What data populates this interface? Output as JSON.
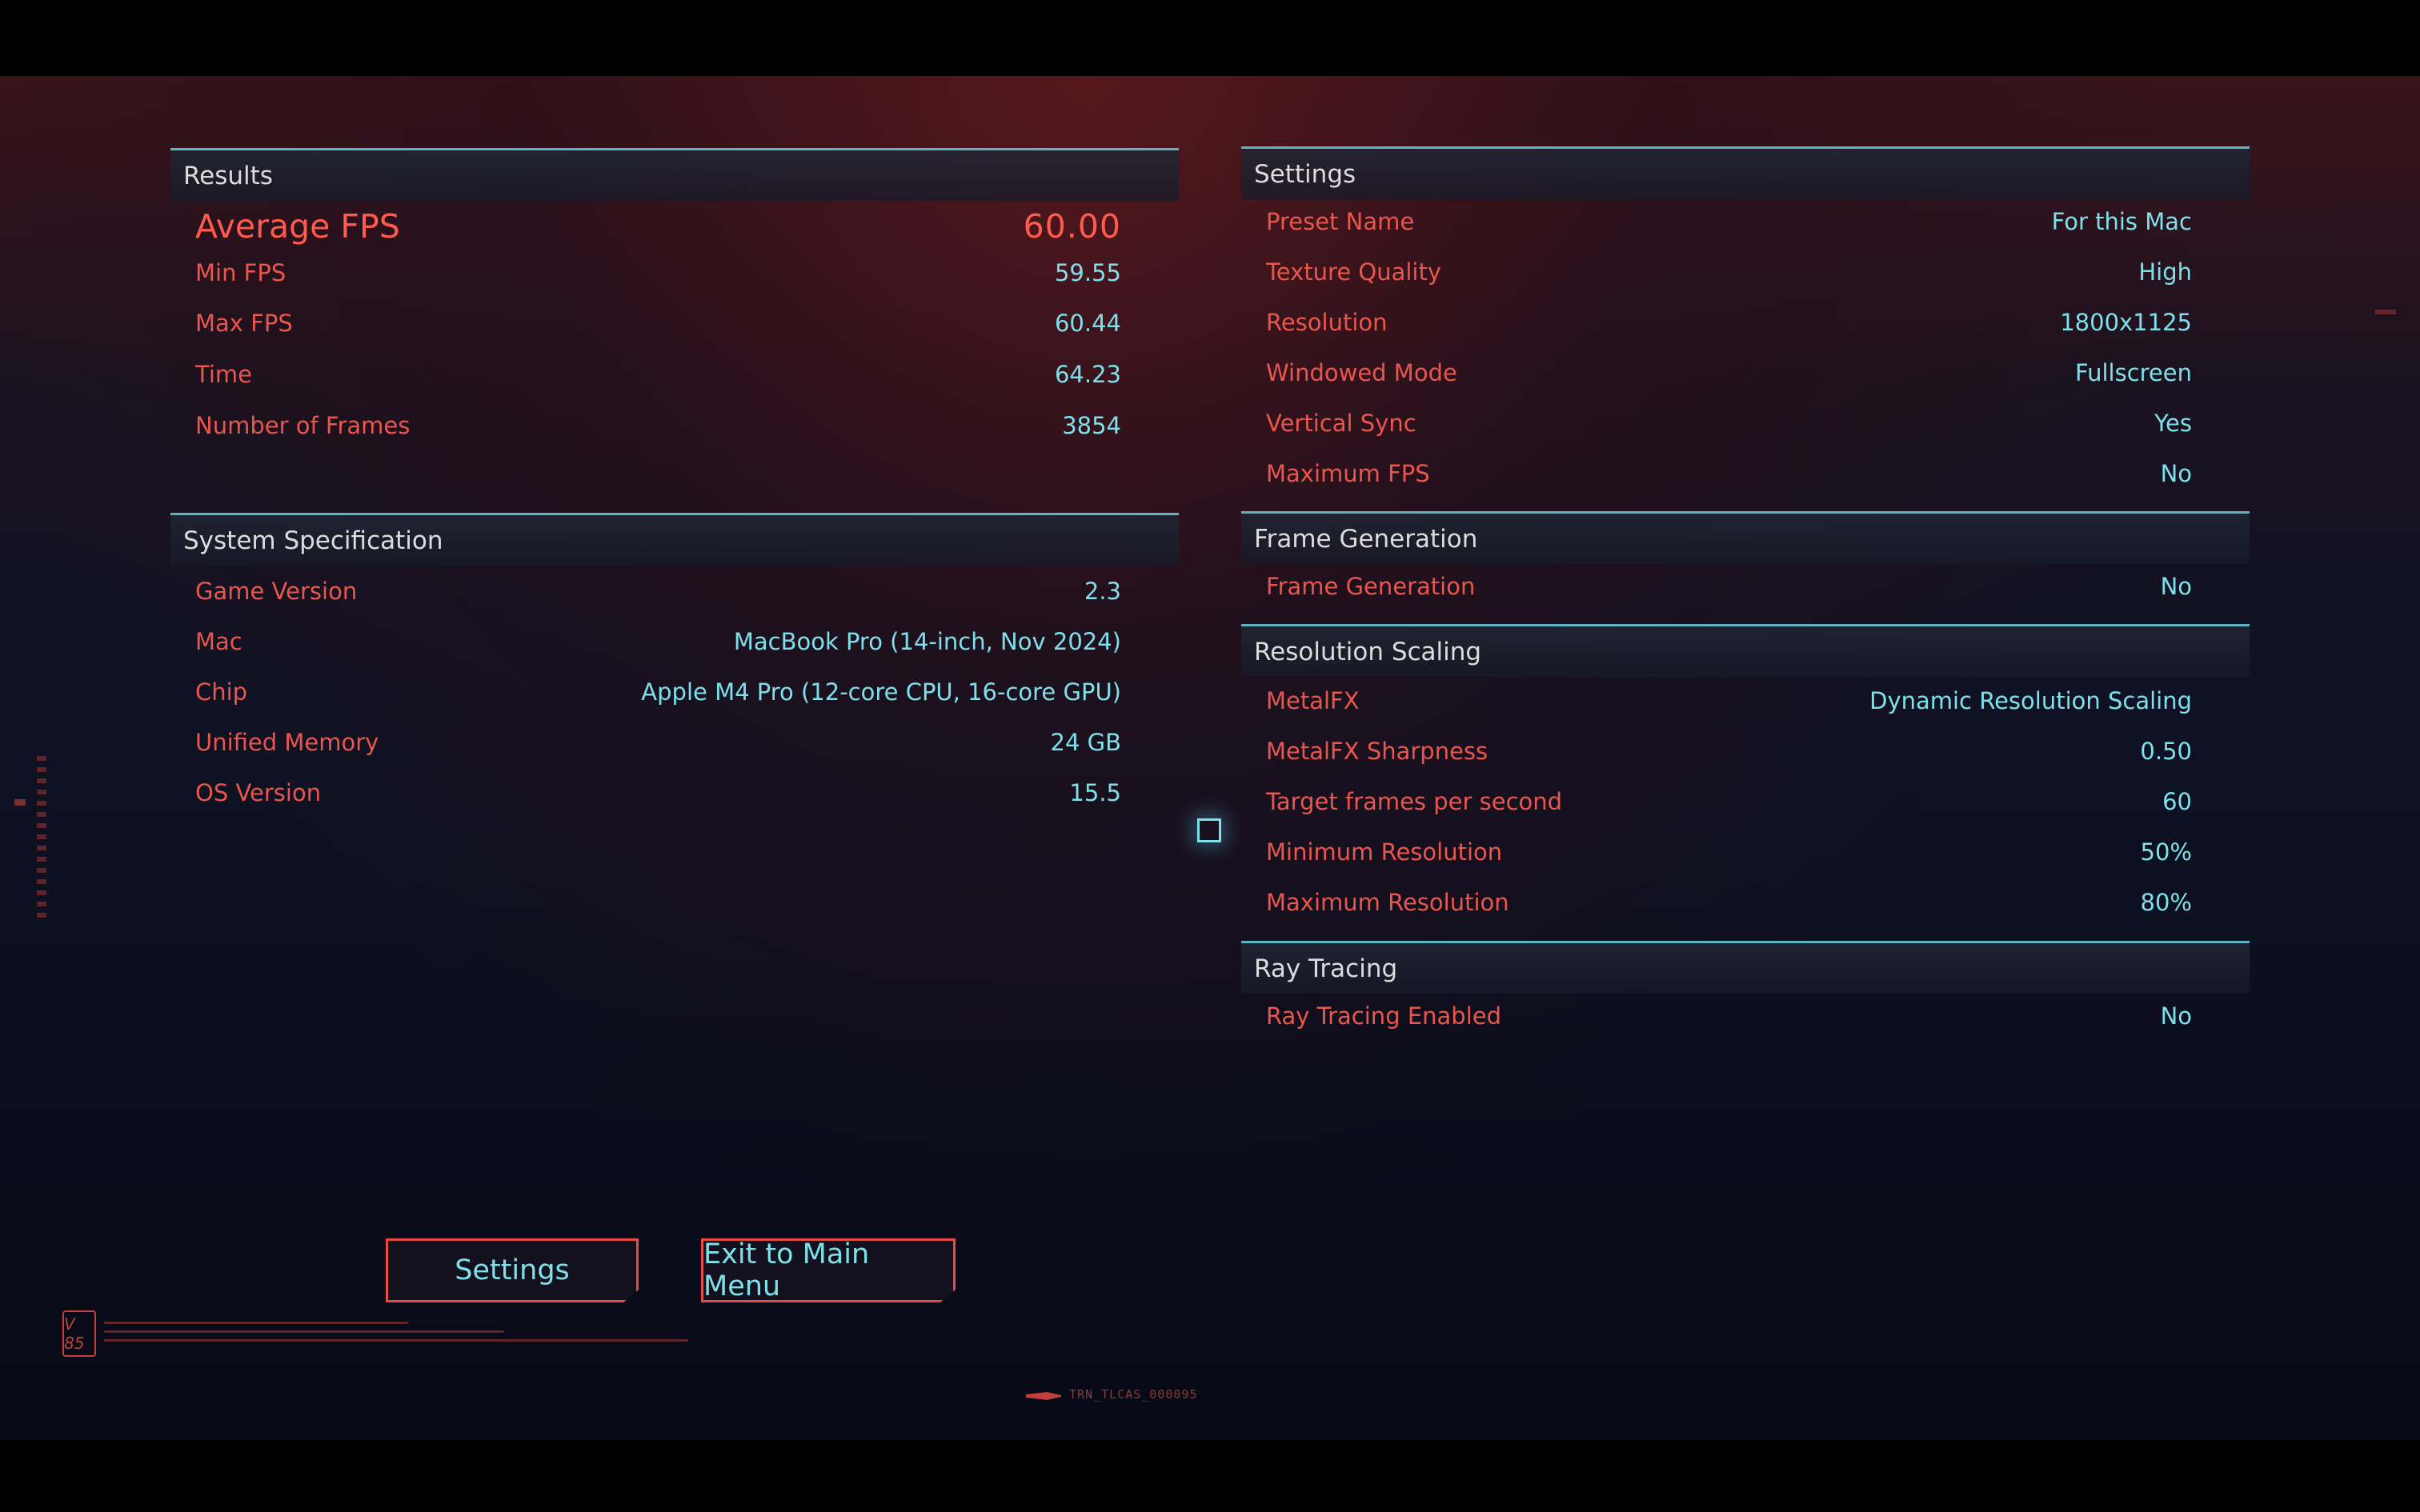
{
  "results": {
    "header": "Results",
    "average": {
      "label": "Average FPS",
      "value": "60.00"
    },
    "rows": [
      {
        "label": "Min FPS",
        "value": "59.55"
      },
      {
        "label": "Max FPS",
        "value": "60.44"
      },
      {
        "label": "Time",
        "value": "64.23"
      },
      {
        "label": "Number of Frames",
        "value": "3854"
      }
    ]
  },
  "system": {
    "header": "System Specification",
    "rows": [
      {
        "label": "Game Version",
        "value": "2.3"
      },
      {
        "label": "Mac",
        "value": "MacBook Pro (14-inch, Nov 2024)"
      },
      {
        "label": "Chip",
        "value": "Apple M4 Pro (12-core CPU, 16-core GPU)"
      },
      {
        "label": "Unified Memory",
        "value": "24 GB"
      },
      {
        "label": "OS Version",
        "value": "15.5"
      }
    ]
  },
  "settings": {
    "header": "Settings",
    "rows": [
      {
        "label": "Preset Name",
        "value": "For this Mac"
      },
      {
        "label": "Texture Quality",
        "value": "High"
      },
      {
        "label": "Resolution",
        "value": "1800x1125"
      },
      {
        "label": "Windowed Mode",
        "value": "Fullscreen"
      },
      {
        "label": "Vertical Sync",
        "value": "Yes"
      },
      {
        "label": "Maximum FPS",
        "value": "No"
      }
    ]
  },
  "frame_generation": {
    "header": "Frame Generation",
    "rows": [
      {
        "label": "Frame Generation",
        "value": "No"
      }
    ]
  },
  "resolution_scaling": {
    "header": "Resolution Scaling",
    "rows": [
      {
        "label": "MetalFX",
        "value": "Dynamic Resolution Scaling"
      },
      {
        "label": "MetalFX Sharpness",
        "value": "0.50"
      },
      {
        "label": "Target frames per second",
        "value": "60"
      },
      {
        "label": "Minimum Resolution",
        "value": "50%"
      },
      {
        "label": "Maximum Resolution",
        "value": "80%"
      }
    ]
  },
  "ray_tracing": {
    "header": "Ray Tracing",
    "rows": [
      {
        "label": "Ray Tracing Enabled",
        "value": "No"
      }
    ]
  },
  "buttons": {
    "settings": "Settings",
    "exit": "Exit to Main Menu"
  },
  "footer": {
    "badge": "V 85",
    "code": "TRN_TLCAS_000095"
  },
  "colors": {
    "label": "#e8564e",
    "value": "#7ee0ea",
    "divider": "#5fb4c2",
    "button_border": "#e84a44"
  }
}
